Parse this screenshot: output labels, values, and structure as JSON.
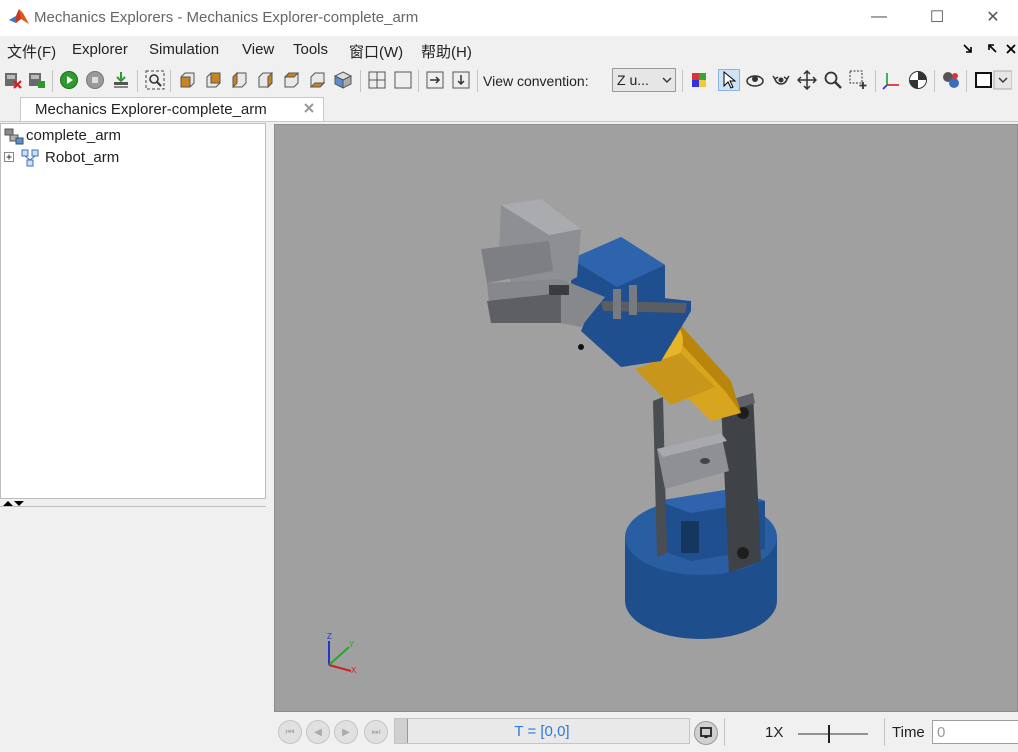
{
  "window": {
    "title": "Mechanics Explorers - Mechanics Explorer-complete_arm",
    "minimize": "—",
    "maximize": "☐",
    "close": "✕"
  },
  "menu": {
    "items": [
      "文件(F)",
      "Explorer",
      "Simulation",
      "View",
      "Tools",
      "窗口(W)",
      "帮助(H)"
    ]
  },
  "toolbar": {
    "view_convention_label": "View convention:",
    "view_convention_value": "Z u..."
  },
  "tab": {
    "label": "Mechanics Explorer-complete_arm"
  },
  "tree": {
    "root": "complete_arm",
    "child": "Robot_arm"
  },
  "triad": {
    "x": "X",
    "y": "Y",
    "z": "Z"
  },
  "playback": {
    "time_display": "T = [0,0]",
    "speed": "1X",
    "time_label": "Time",
    "time_value": "0"
  },
  "colors": {
    "viewport_bg": "#a0a0a0",
    "robot_blue": "#1a4f8f",
    "robot_gold": "#d9a51e",
    "robot_grey": "#8e9093",
    "accent_blue": "#2a7bd4"
  }
}
